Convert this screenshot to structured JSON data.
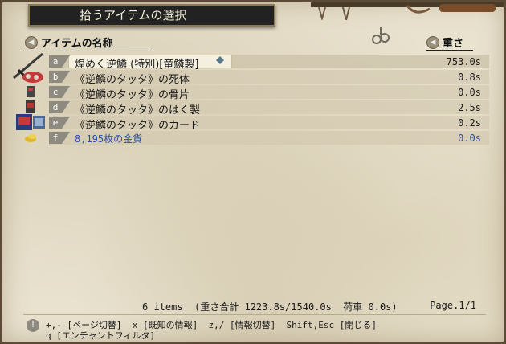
{
  "window": {
    "title": "拾うアイテムの選択"
  },
  "header": {
    "name_label": "アイテムの名称",
    "weight_label": "重さ"
  },
  "items": [
    {
      "key": "a",
      "name": "煌めく逆鱗 (特別)[竜鱗製]",
      "weight": "753.0s",
      "selected": true
    },
    {
      "key": "b",
      "name": "《逆鱗のタッタ》の死体",
      "weight": "0.8s"
    },
    {
      "key": "c",
      "name": "《逆鱗のタッタ》の骨片",
      "weight": "0.0s"
    },
    {
      "key": "d",
      "name": "《逆鱗のタッタ》のはく製",
      "weight": "2.5s"
    },
    {
      "key": "e",
      "name": "《逆鱗のタッタ》のカード",
      "weight": "0.2s"
    },
    {
      "key": "f",
      "name": "8,195枚の金貨",
      "weight": "0.0s",
      "gold": true
    }
  ],
  "footer": {
    "items_count": "6 items",
    "total_weight": "(重さ合計 1223.8s/1540.0s  荷車 0.0s)",
    "page": "Page.1/1"
  },
  "help": {
    "line1": "+,- [ページ切替]  x [既知の情報]  z,/ [情報切替]  Shift,Esc [閉じる]",
    "line2": "q [エンチャントフィルタ]"
  },
  "colors": {
    "gold_text": "#2c4fa8",
    "parchment": "#e9e2cf",
    "title_bg": "#222222"
  }
}
